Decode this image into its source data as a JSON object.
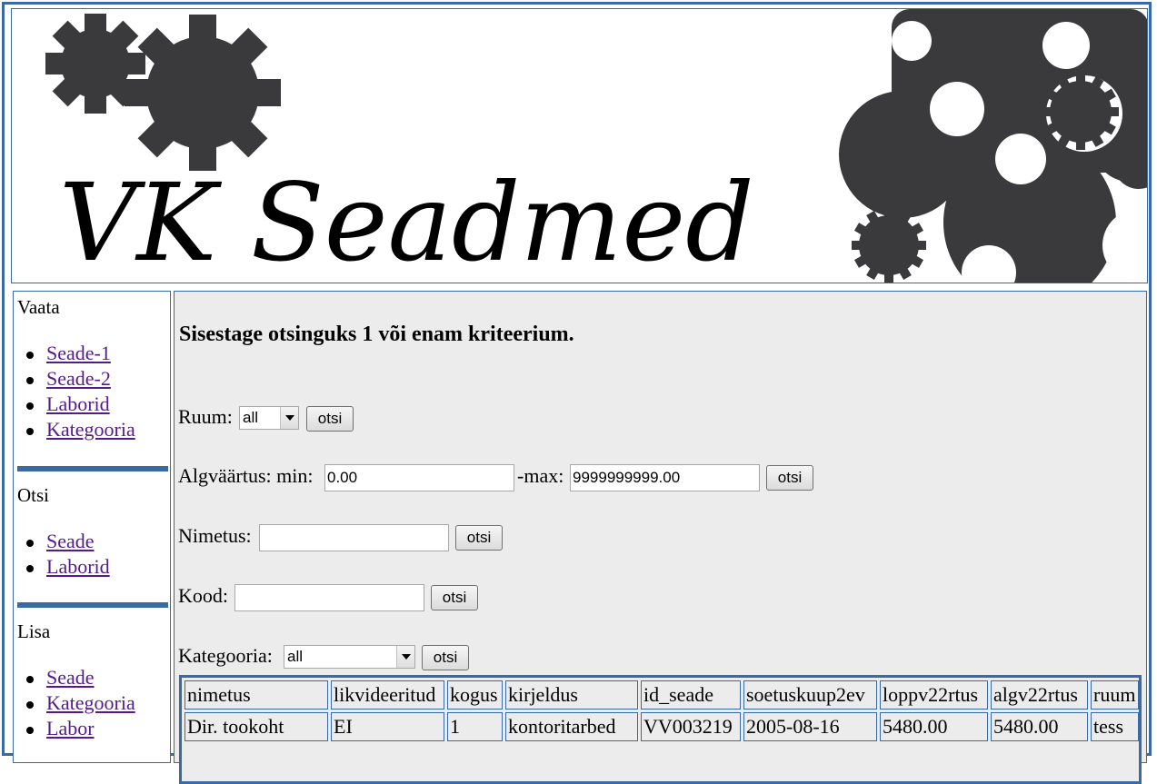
{
  "header": {
    "logo_text": "VK Seadmed"
  },
  "sidebar": {
    "vaata": {
      "title": "Vaata",
      "items": [
        "Seade-1",
        "Seade-2",
        "Laborid",
        "Kategooria"
      ]
    },
    "otsi": {
      "title": "Otsi",
      "items": [
        "Seade",
        "Laborid"
      ]
    },
    "lisa": {
      "title": "Lisa",
      "items": [
        "Seade",
        "Kategooria",
        "Labor"
      ]
    }
  },
  "main": {
    "heading": "Sisestage otsinguks 1 või enam kriteerium.",
    "ruum": {
      "label": "Ruum:",
      "selected": "all",
      "button": "otsi"
    },
    "algvaartus": {
      "label": "Algväärtus: min:",
      "min_value": "0.00",
      "max_label": "-max:",
      "max_value": "9999999999.00",
      "button": "otsi"
    },
    "nimetus": {
      "label": "Nimetus:",
      "value": "",
      "button": "otsi"
    },
    "kood": {
      "label": "Kood:",
      "value": "",
      "button": "otsi"
    },
    "kategooria": {
      "label": "Kategooria:",
      "selected": "all",
      "button": "otsi"
    }
  },
  "table": {
    "columns": [
      "nimetus",
      "likvideeritud",
      "kogus",
      "kirjeldus",
      "id_seade",
      "soetuskuup2ev",
      "loppv22rtus",
      "algv22rtus",
      "ruum"
    ],
    "rows": [
      [
        "Dir. tookoht",
        "EI",
        "1",
        "kontoritarbed",
        "VV003219",
        "2005-08-16",
        "5480.00",
        "5480.00",
        "tess"
      ]
    ]
  },
  "colors": {
    "border_blue": "#3a6aa5",
    "link": "#551a8b",
    "panel_bg": "#ececec",
    "gear": "#3a3a3c"
  }
}
